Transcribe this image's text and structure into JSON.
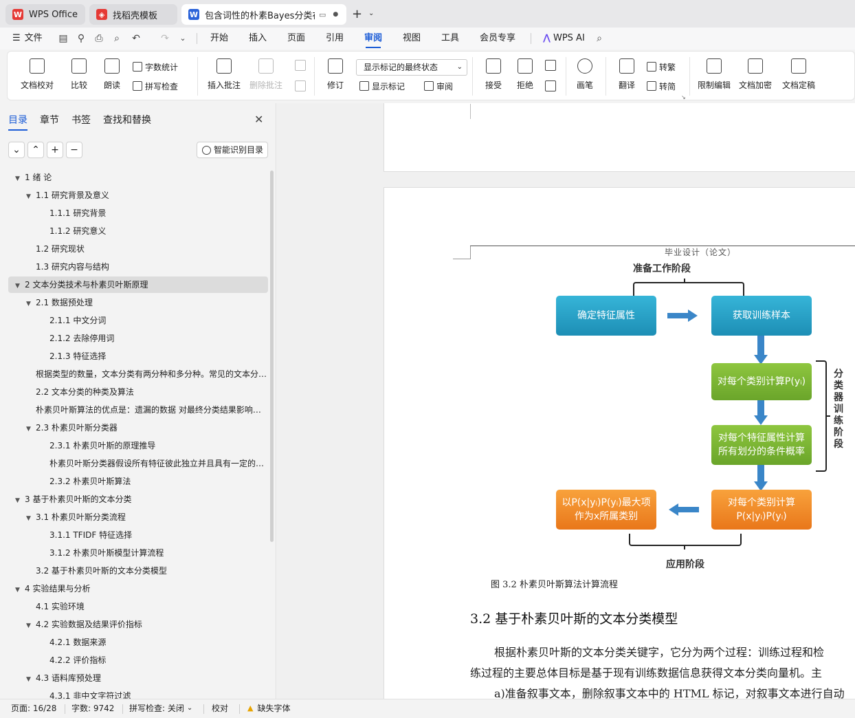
{
  "tabs": [
    {
      "label": "WPS Office"
    },
    {
      "label": "找稻壳模板"
    },
    {
      "label": "包含词性的朴素Bayes分类在"
    }
  ],
  "menu": {
    "file": "文件",
    "items": [
      "开始",
      "插入",
      "页面",
      "引用",
      "审阅",
      "视图",
      "工具",
      "会员专享"
    ],
    "active": "审阅",
    "wps_ai": "WPS AI"
  },
  "ribbon": {
    "proofread": "文档校对",
    "compare": "比较",
    "read_aloud": "朗读",
    "word_count": "字数统计",
    "spell_check": "拼写检查",
    "insert_comment": "插入批注",
    "delete_comment": "删除批注",
    "revise": "修订",
    "mark_state": "显示标记的最终状态",
    "show_marks": "显示标记",
    "review": "审阅",
    "accept": "接受",
    "reject": "拒绝",
    "pen": "画笔",
    "translate": "翻译",
    "to_traditional": "转繁",
    "to_simplified": "转简",
    "restrict_edit": "限制编辑",
    "encrypt": "文档加密",
    "finalize": "文档定稿"
  },
  "nav": {
    "tabs": [
      "目录",
      "章节",
      "书签",
      "查找和替换"
    ],
    "smart_toc": "智能识别目录",
    "toc": [
      {
        "level": 1,
        "arrow": true,
        "text": "1 绪  论"
      },
      {
        "level": 2,
        "arrow": true,
        "text": "1.1  研究背景及意义"
      },
      {
        "level": 3,
        "arrow": false,
        "text": "1.1.1  研究背景"
      },
      {
        "level": 3,
        "arrow": false,
        "text": "1.1.2  研究意义"
      },
      {
        "level": 2,
        "arrow": false,
        "text": "1.2  研究现状"
      },
      {
        "level": 2,
        "arrow": false,
        "text": "1.3  研究内容与结构"
      },
      {
        "level": 1,
        "arrow": true,
        "text": "2 文本分类技术与朴素贝叶斯原理",
        "selected": true
      },
      {
        "level": 2,
        "arrow": true,
        "text": "2.1  数据预处理"
      },
      {
        "level": 3,
        "arrow": false,
        "text": "2.1.1  中文分词"
      },
      {
        "level": 3,
        "arrow": false,
        "text": "2.1.2  去除停用词"
      },
      {
        "level": 3,
        "arrow": false,
        "text": "2.1.3  特征选择"
      },
      {
        "level": 2,
        "arrow": false,
        "text": "根据类型的数量，文本分类有两分种和多分种。常见的文本分类算法有"
      },
      {
        "level": 2,
        "arrow": false,
        "text": "2.2    文本分类的种类及算法"
      },
      {
        "level": 2,
        "arrow": false,
        "text": "朴素贝叶斯算法的优点是：遗漏的数据    对最终分类结果影响不大"
      },
      {
        "level": 2,
        "arrow": true,
        "text": "2.3  朴素贝叶斯分类器"
      },
      {
        "level": 3,
        "arrow": false,
        "text": "2.3.1    朴素贝叶斯的原理推导"
      },
      {
        "level": 3,
        "arrow": false,
        "text": "朴素贝叶斯分类器假设所有特征彼此独立并且具有一定的相关性"
      },
      {
        "level": 3,
        "arrow": false,
        "text": "2.3.2    朴素贝叶斯算法"
      },
      {
        "level": 1,
        "arrow": true,
        "text": "3  基于朴素贝叶斯的文本分类"
      },
      {
        "level": 2,
        "arrow": true,
        "text": "3.1  朴素贝叶斯分类流程"
      },
      {
        "level": 3,
        "arrow": false,
        "text": "3.1.1 TFIDF 特征选择"
      },
      {
        "level": 3,
        "arrow": false,
        "text": "3.1.2  朴素贝叶斯模型计算流程"
      },
      {
        "level": 2,
        "arrow": false,
        "text": "3.2 基于朴素贝叶斯的文本分类模型"
      },
      {
        "level": 1,
        "arrow": true,
        "text": "4  实验结果与分析"
      },
      {
        "level": 2,
        "arrow": false,
        "text": "4.1 实验环境"
      },
      {
        "level": 2,
        "arrow": true,
        "text": "4.2 实验数据及结果评价指标"
      },
      {
        "level": 3,
        "arrow": false,
        "text": "4.2.1  数据来源"
      },
      {
        "level": 3,
        "arrow": false,
        "text": "4.2.2  评价指标"
      },
      {
        "level": 2,
        "arrow": true,
        "text": "4.3 语料库预处理"
      },
      {
        "level": 3,
        "arrow": false,
        "text": "4.3.1  非中文字符过滤"
      }
    ]
  },
  "doc": {
    "header": "毕业设计（论文）",
    "diagram": {
      "prep_stage": "准备工作阶段",
      "box_feature": "确定特征属性",
      "box_samples": "获取训练样本",
      "box_class_prob": "对每个类别计算P(yᵢ)",
      "box_cond_prob_1": "对每个特征属性计算",
      "box_cond_prob_2": "所有划分的条件概率",
      "box_joint_1": "对每个类别计算",
      "box_joint_2": "P(x|yᵢ)P(yᵢ)",
      "box_result_1": "以P(x|yᵢ)P(yᵢ)最大项",
      "box_result_2": "作为x所属类别",
      "train_stage": "分类器训练阶段",
      "apply_stage": "应用阶段"
    },
    "caption": "图 3.2    朴素贝叶斯算法计算流程",
    "heading": "3.2 基于朴素贝叶斯的文本分类模型",
    "para1": "根据朴素贝叶斯的文本分类关键字，它分为两个过程：训练过程和检",
    "para2": "练过程的主要总体目标是基于现有训练数据信息获得文本分类向量机。主",
    "para3": "a)准备叙事文本，删除叙事文本中的 HTML 标记，对叙事文本进行自动"
  },
  "status": {
    "page": "页面: 16/28",
    "words": "字数: 9742",
    "spell": "拼写检查: 关闭",
    "proof": "校对",
    "missing_font": "缺失字体"
  }
}
